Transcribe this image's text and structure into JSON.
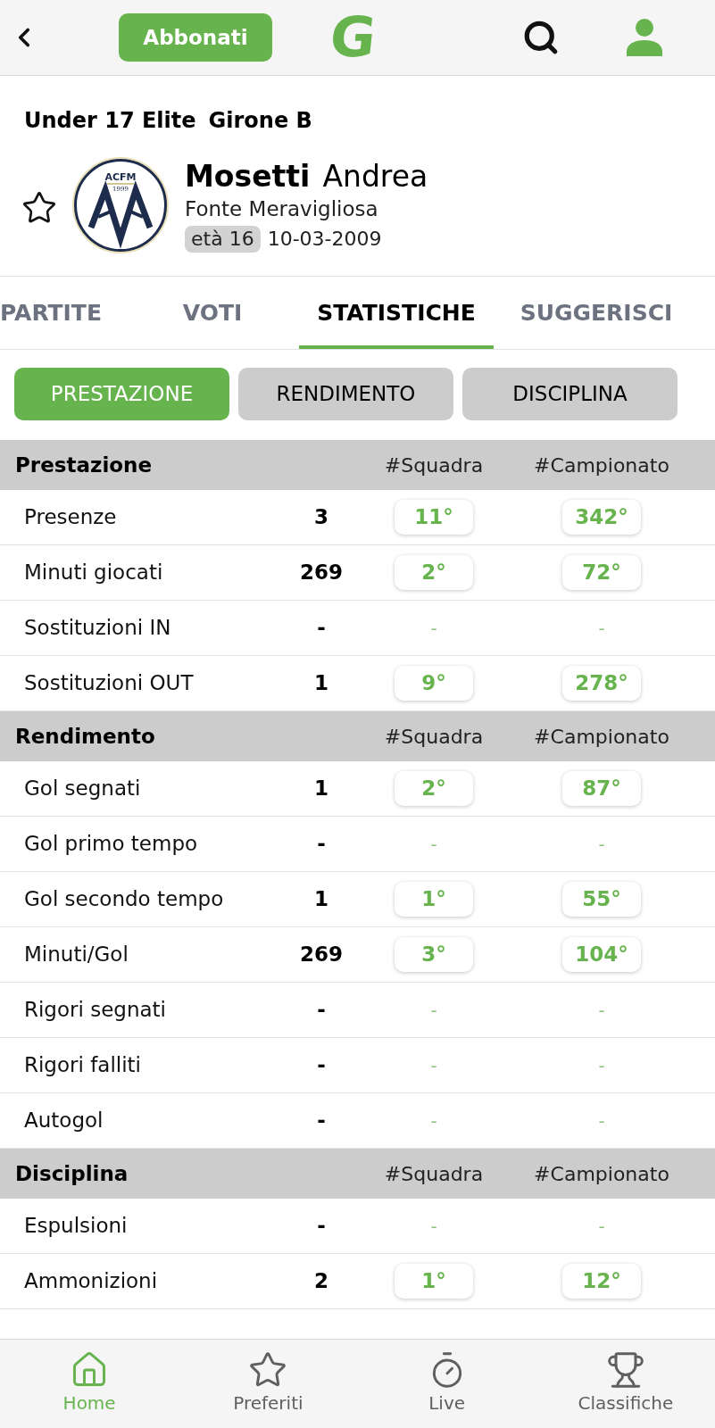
{
  "top_bar": {
    "subscribe_button": "Abbonati",
    "logo": "G"
  },
  "competition": {
    "name": "Under 17 Elite",
    "group": "Girone B"
  },
  "player": {
    "favorite": false,
    "surname": "Mosetti",
    "first_name": "Andrea",
    "club": "Fonte Meravigliosa",
    "crest": {
      "initials": "ACFM",
      "year": "1999"
    },
    "age": "età 16",
    "birth_date": "10-03-2009"
  },
  "tabs": [
    {
      "label": "PARTITE",
      "selected": false
    },
    {
      "label": "VOTI",
      "selected": false
    },
    {
      "label": "STATISTICHE",
      "selected": true
    },
    {
      "label": "SUGGERISCI",
      "selected": false
    }
  ],
  "segments": [
    {
      "label": "PRESTAZIONE",
      "selected": true
    },
    {
      "label": "RENDIMENTO",
      "selected": false
    },
    {
      "label": "DISCIPLINA",
      "selected": false
    }
  ],
  "sections": [
    {
      "title": "Prestazione",
      "columns": [
        "#Squadra",
        "#Campionato"
      ],
      "rows": [
        {
          "label": "Presenze",
          "value": "3",
          "ranked": true,
          "team_rank": "11°",
          "league_rank": "342°"
        },
        {
          "label": "Minuti giocati",
          "value": "269",
          "ranked": true,
          "team_rank": "2°",
          "league_rank": "72°"
        },
        {
          "label": "Sostituzioni IN",
          "value": "-",
          "ranked": false,
          "team_rank": "-",
          "league_rank": "-"
        },
        {
          "label": "Sostituzioni OUT",
          "value": "1",
          "ranked": true,
          "team_rank": "9°",
          "league_rank": "278°"
        }
      ]
    },
    {
      "title": "Rendimento",
      "columns": [
        "#Squadra",
        "#Campionato"
      ],
      "rows": [
        {
          "label": "Gol segnati",
          "value": "1",
          "ranked": true,
          "team_rank": "2°",
          "league_rank": "87°"
        },
        {
          "label": "Gol primo tempo",
          "value": "-",
          "ranked": false,
          "team_rank": "-",
          "league_rank": "-"
        },
        {
          "label": "Gol secondo tempo",
          "value": "1",
          "ranked": true,
          "team_rank": "1°",
          "league_rank": "55°"
        },
        {
          "label": "Minuti/Gol",
          "value": "269",
          "ranked": true,
          "team_rank": "3°",
          "league_rank": "104°"
        },
        {
          "label": "Rigori segnati",
          "value": "-",
          "ranked": false,
          "team_rank": "-",
          "league_rank": "-"
        },
        {
          "label": "Rigori falliti",
          "value": "-",
          "ranked": false,
          "team_rank": "-",
          "league_rank": "-"
        },
        {
          "label": "Autogol",
          "value": "-",
          "ranked": false,
          "team_rank": "-",
          "league_rank": "-"
        }
      ]
    },
    {
      "title": "Disciplina",
      "columns": [
        "#Squadra",
        "#Campionato"
      ],
      "rows": [
        {
          "label": "Espulsioni",
          "value": "-",
          "ranked": false,
          "team_rank": "-",
          "league_rank": "-"
        },
        {
          "label": "Ammonizioni",
          "value": "2",
          "ranked": true,
          "team_rank": "1°",
          "league_rank": "12°"
        }
      ]
    }
  ],
  "nav": [
    {
      "label": "Home",
      "selected": true
    },
    {
      "label": "Preferiti",
      "selected": false
    },
    {
      "label": "Live",
      "selected": false
    },
    {
      "label": "Classifiche",
      "selected": false
    }
  ]
}
